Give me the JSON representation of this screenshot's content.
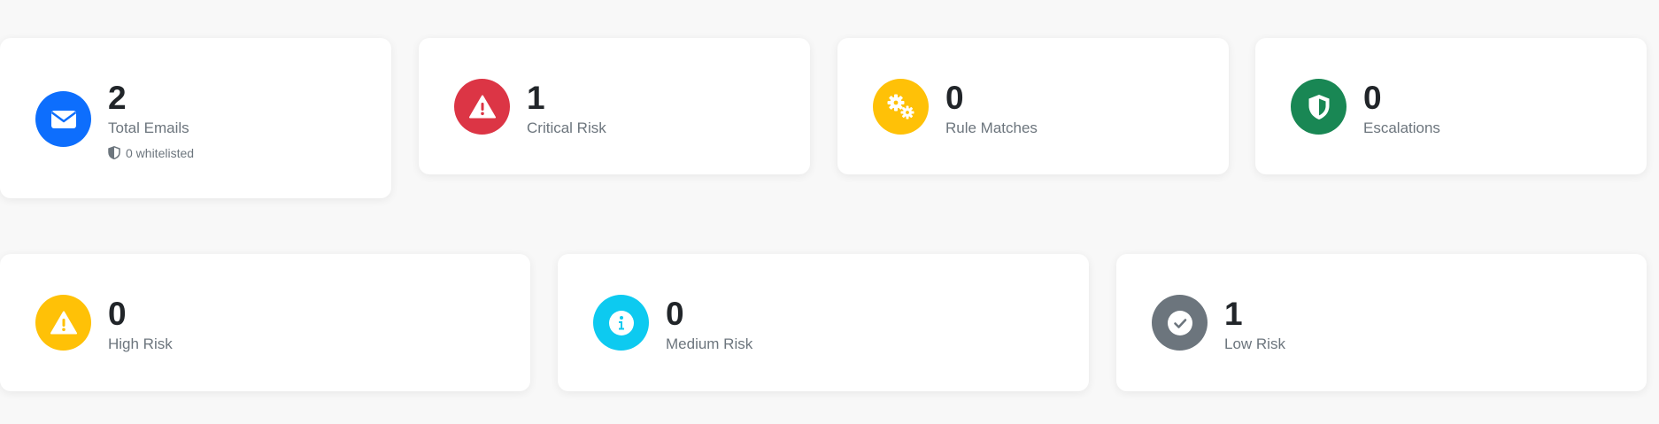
{
  "row1": [
    {
      "key": "total-emails",
      "value": "2",
      "label": "Total Emails",
      "sub": "0 whitelisted",
      "color": "#0d6efd",
      "icon": "envelope-icon"
    },
    {
      "key": "critical-risk",
      "value": "1",
      "label": "Critical Risk",
      "color": "#dc3545",
      "icon": "warning-triangle-icon"
    },
    {
      "key": "rule-matches",
      "value": "0",
      "label": "Rule Matches",
      "color": "#ffc107",
      "icon": "gears-icon"
    },
    {
      "key": "escalations",
      "value": "0",
      "label": "Escalations",
      "color": "#198754",
      "icon": "shield-icon"
    }
  ],
  "row2": [
    {
      "key": "high-risk",
      "value": "0",
      "label": "High Risk",
      "color": "#ffc107",
      "icon": "warning-triangle-icon"
    },
    {
      "key": "medium-risk",
      "value": "0",
      "label": "Medium Risk",
      "color": "#0dcaf0",
      "icon": "info-circle-icon"
    },
    {
      "key": "low-risk",
      "value": "1",
      "label": "Low Risk",
      "color": "#6c757d",
      "icon": "check-circle-icon"
    }
  ]
}
